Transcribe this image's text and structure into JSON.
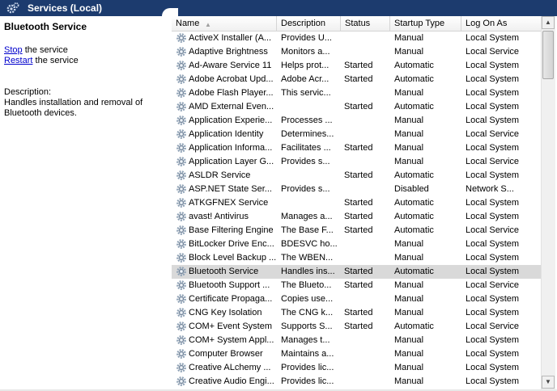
{
  "window": {
    "title": "Services (Local)",
    "accent": "#1c3b6e"
  },
  "detail": {
    "service_name": "Bluetooth Service",
    "stop_link": "Stop",
    "stop_suffix": " the service",
    "restart_link": "Restart",
    "restart_suffix": " the service",
    "description_label": "Description:",
    "description_text": "Handles installation and removal of Bluetooth devices."
  },
  "table": {
    "columns": [
      {
        "key": "name",
        "label": "Name",
        "sorted": "ascending"
      },
      {
        "key": "description",
        "label": "Description"
      },
      {
        "key": "status",
        "label": "Status"
      },
      {
        "key": "startup",
        "label": "Startup Type"
      },
      {
        "key": "logon",
        "label": "Log On As"
      }
    ],
    "selected_index": 17,
    "rows": [
      {
        "name": "ActiveX Installer (A...",
        "description": "Provides U...",
        "status": "",
        "startup": "Manual",
        "logon": "Local System"
      },
      {
        "name": "Adaptive Brightness",
        "description": "Monitors a...",
        "status": "",
        "startup": "Manual",
        "logon": "Local Service"
      },
      {
        "name": "Ad-Aware Service 11",
        "description": "Helps prot...",
        "status": "Started",
        "startup": "Automatic",
        "logon": "Local System"
      },
      {
        "name": "Adobe Acrobat Upd...",
        "description": "Adobe Acr...",
        "status": "Started",
        "startup": "Automatic",
        "logon": "Local System"
      },
      {
        "name": "Adobe Flash Player...",
        "description": "This servic...",
        "status": "",
        "startup": "Manual",
        "logon": "Local System"
      },
      {
        "name": "AMD External Even...",
        "description": "",
        "status": "Started",
        "startup": "Automatic",
        "logon": "Local System"
      },
      {
        "name": "Application Experie...",
        "description": "Processes ...",
        "status": "",
        "startup": "Manual",
        "logon": "Local System"
      },
      {
        "name": "Application Identity",
        "description": "Determines...",
        "status": "",
        "startup": "Manual",
        "logon": "Local Service"
      },
      {
        "name": "Application Informa...",
        "description": "Facilitates ...",
        "status": "Started",
        "startup": "Manual",
        "logon": "Local System"
      },
      {
        "name": "Application Layer G...",
        "description": "Provides s...",
        "status": "",
        "startup": "Manual",
        "logon": "Local Service"
      },
      {
        "name": "ASLDR Service",
        "description": "",
        "status": "Started",
        "startup": "Automatic",
        "logon": "Local System"
      },
      {
        "name": "ASP.NET State Ser...",
        "description": "Provides s...",
        "status": "",
        "startup": "Disabled",
        "logon": "Network S..."
      },
      {
        "name": "ATKGFNEX Service",
        "description": "",
        "status": "Started",
        "startup": "Automatic",
        "logon": "Local System"
      },
      {
        "name": "avast! Antivirus",
        "description": "Manages a...",
        "status": "Started",
        "startup": "Automatic",
        "logon": "Local System"
      },
      {
        "name": "Base Filtering Engine",
        "description": "The Base F...",
        "status": "Started",
        "startup": "Automatic",
        "logon": "Local Service"
      },
      {
        "name": "BitLocker Drive Enc...",
        "description": "BDESVC ho...",
        "status": "",
        "startup": "Manual",
        "logon": "Local System"
      },
      {
        "name": "Block Level Backup ...",
        "description": "The WBEN...",
        "status": "",
        "startup": "Manual",
        "logon": "Local System"
      },
      {
        "name": "Bluetooth Service",
        "description": "Handles ins...",
        "status": "Started",
        "startup": "Automatic",
        "logon": "Local System"
      },
      {
        "name": "Bluetooth Support ...",
        "description": "The Blueto...",
        "status": "Started",
        "startup": "Manual",
        "logon": "Local Service"
      },
      {
        "name": "Certificate Propaga...",
        "description": "Copies use...",
        "status": "",
        "startup": "Manual",
        "logon": "Local System"
      },
      {
        "name": "CNG Key Isolation",
        "description": "The CNG k...",
        "status": "Started",
        "startup": "Manual",
        "logon": "Local System"
      },
      {
        "name": "COM+ Event System",
        "description": "Supports S...",
        "status": "Started",
        "startup": "Automatic",
        "logon": "Local Service"
      },
      {
        "name": "COM+ System Appl...",
        "description": "Manages t...",
        "status": "",
        "startup": "Manual",
        "logon": "Local System"
      },
      {
        "name": "Computer Browser",
        "description": "Maintains a...",
        "status": "",
        "startup": "Manual",
        "logon": "Local System"
      },
      {
        "name": "Creative ALchemy ...",
        "description": "Provides lic...",
        "status": "",
        "startup": "Manual",
        "logon": "Local System"
      },
      {
        "name": "Creative Audio Engi...",
        "description": "Provides lic...",
        "status": "",
        "startup": "Manual",
        "logon": "Local System"
      }
    ]
  },
  "scrollbar": {
    "up_arrow": "▲",
    "down_arrow": "▼"
  },
  "icons": {
    "title": "gear-icon",
    "row": "service-gear-icon",
    "sort": "sort-ascending-icon"
  }
}
